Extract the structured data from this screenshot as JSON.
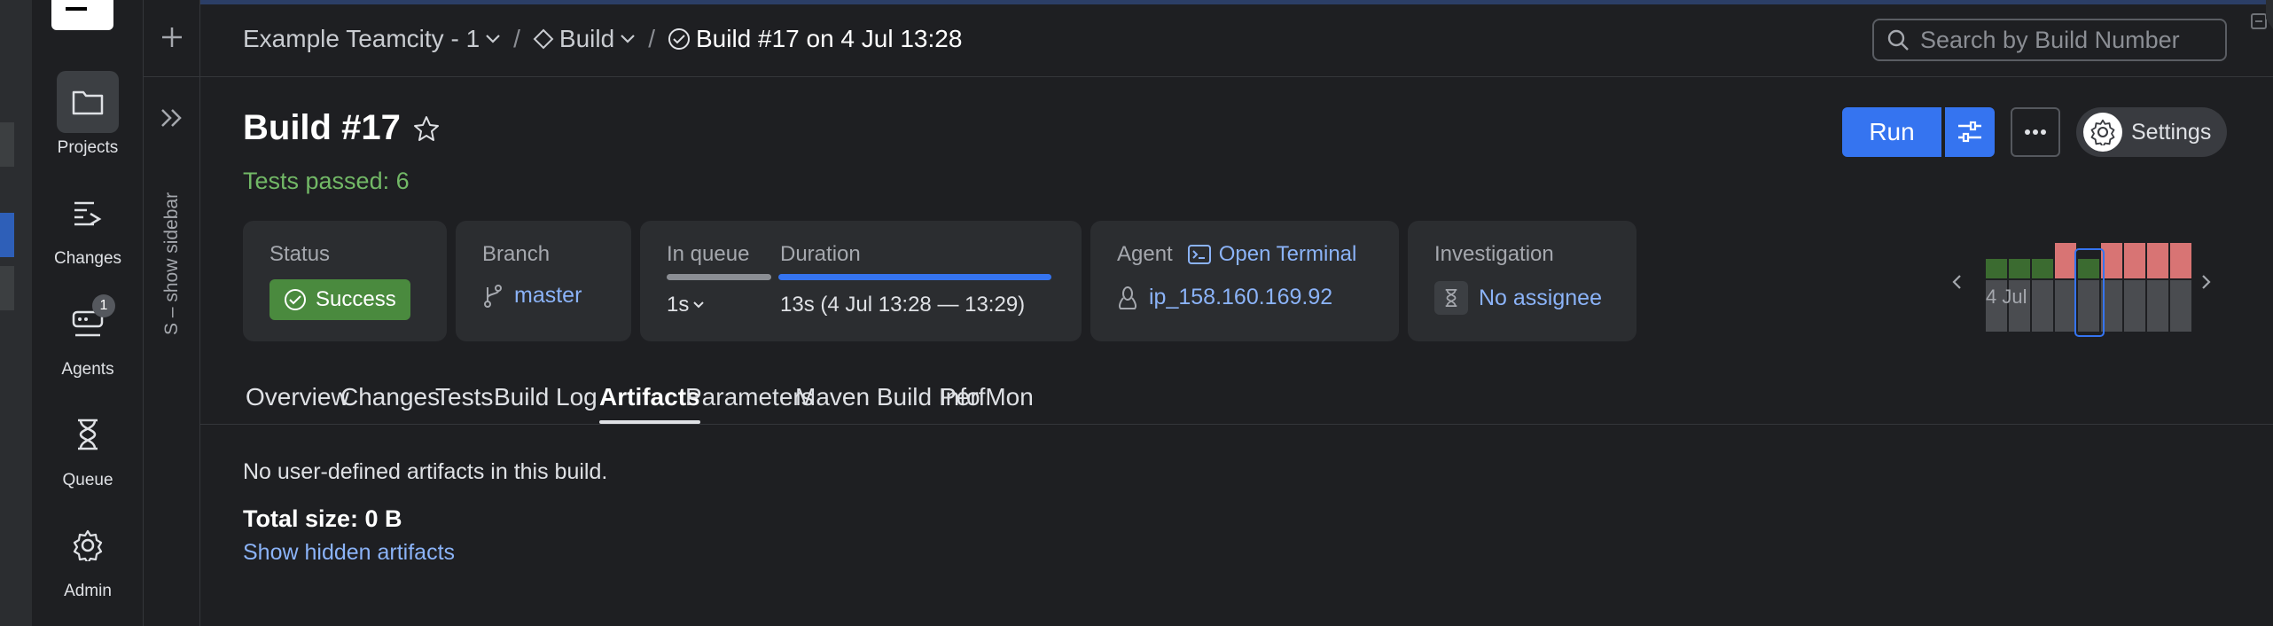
{
  "nav": {
    "items": [
      {
        "label": "Projects"
      },
      {
        "label": "Changes"
      },
      {
        "label": "Agents",
        "badge": "1"
      },
      {
        "label": "Queue"
      },
      {
        "label": "Admin"
      }
    ]
  },
  "rail": {
    "show_sidebar_label": "S – show sidebar"
  },
  "breadcrumb": {
    "project": "Example Teamcity - 1",
    "build_config": "Build",
    "current": "Build #17 on 4 Jul 13:28"
  },
  "search": {
    "placeholder": "Search by Build Number"
  },
  "header": {
    "title": "Build #17",
    "tests_summary": "Tests passed: 6",
    "run_label": "Run",
    "settings_label": "Settings"
  },
  "cards": {
    "status": {
      "label": "Status",
      "value": "Success"
    },
    "branch": {
      "label": "Branch",
      "value": "master"
    },
    "queue": {
      "label": "In queue",
      "value": "1s"
    },
    "duration": {
      "label": "Duration",
      "value": "13s (4 Jul 13:28 — 13:29)",
      "progress": 1.0
    },
    "agent": {
      "label": "Agent",
      "terminal_label": "Open Terminal",
      "value": "ip_158.160.169.92"
    },
    "investigation": {
      "label": "Investigation",
      "value": "No assignee"
    }
  },
  "history": {
    "date_label": "4 Jul",
    "builds": [
      "success",
      "success",
      "success",
      "failed",
      "success",
      "failed",
      "failed",
      "failed",
      "failed"
    ],
    "selected_index": 4,
    "colors": {
      "success": "#3b6b30",
      "failed": "#d87474"
    }
  },
  "tabs": [
    {
      "label": "Overview"
    },
    {
      "label": "Changes"
    },
    {
      "label": "Tests"
    },
    {
      "label": "Build Log"
    },
    {
      "label": "Artifacts",
      "active": true
    },
    {
      "label": "Parameters"
    },
    {
      "label": "Maven Build Info"
    },
    {
      "label": "PerfMon"
    }
  ],
  "content": {
    "empty_message": "No user-defined artifacts in this build.",
    "total_size": "Total size: 0 B",
    "show_hidden": "Show hidden artifacts"
  },
  "colors": {
    "accent": "#3574f0",
    "success": "#4a8a3e",
    "link": "#8bb3f8",
    "tests_green": "#72b866"
  }
}
